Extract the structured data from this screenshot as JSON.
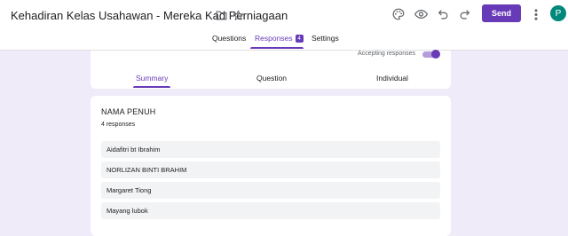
{
  "form": {
    "title": "Kehadiran Kelas Usahawan - Mereka Kad Perniagaan"
  },
  "header": {
    "send_label": "Send",
    "avatar_initial": "P"
  },
  "tabs": [
    {
      "label": "Questions",
      "active": false
    },
    {
      "label": "Responses",
      "active": true,
      "badge": "4"
    },
    {
      "label": "Settings",
      "active": false
    }
  ],
  "responses_panel": {
    "accepting_label": "Accepting responses",
    "accepting": true,
    "subtabs": [
      {
        "label": "Summary",
        "active": true
      },
      {
        "label": "Question",
        "active": false
      },
      {
        "label": "Individual",
        "active": false
      }
    ]
  },
  "question": {
    "title": "NAMA PENUH",
    "count_text": "4 responses",
    "answers": [
      "Aidafitri bt Ibrahim",
      "NORLIZAN BINTI BRAHIM",
      "Margaret Tiong",
      "Mayang lubok"
    ]
  },
  "colors": {
    "accent": "#673ab7",
    "background": "#f0ebf8",
    "avatar": "#00897b"
  },
  "icons": [
    "folder-icon",
    "star-icon",
    "palette-icon",
    "preview-eye-icon",
    "undo-icon",
    "redo-icon",
    "more-vert-icon"
  ]
}
